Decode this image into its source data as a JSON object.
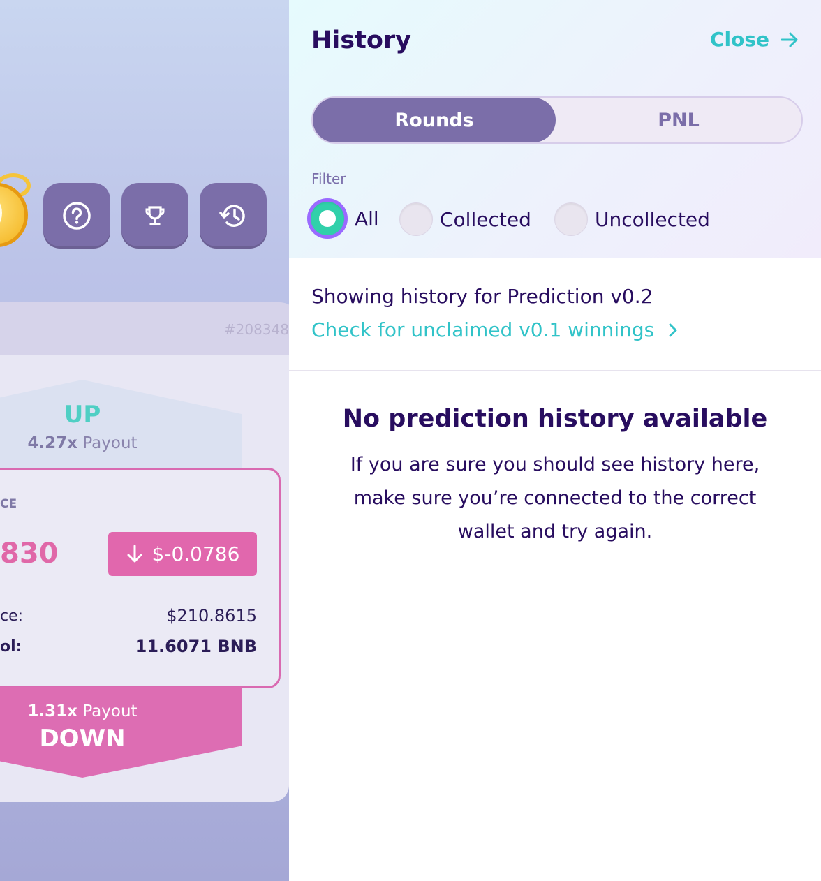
{
  "background": {
    "round_id": "#208348",
    "up": {
      "label": "UP",
      "payout_multiplier": "4.27x",
      "payout_word": "Payout"
    },
    "price": {
      "caption": "CE",
      "value": "830",
      "delta": "$-0.0786",
      "locked_label": "ce:",
      "locked_value": "$210.8615",
      "pool_label": "ol:",
      "pool_value": "11.6071 BNB"
    },
    "down": {
      "label": "DOWN",
      "payout_multiplier": "1.31x",
      "payout_word": "Payout"
    },
    "icons": [
      "timer-icon",
      "help-icon",
      "trophy-icon",
      "history-icon"
    ]
  },
  "panel": {
    "title": "History",
    "close_label": "Close",
    "tabs": [
      {
        "label": "Rounds",
        "active": true
      },
      {
        "label": "PNL",
        "active": false
      }
    ],
    "filter": {
      "label": "Filter",
      "options": [
        {
          "label": "All",
          "checked": true
        },
        {
          "label": "Collected",
          "checked": false
        },
        {
          "label": "Uncollected",
          "checked": false
        }
      ]
    },
    "info_text": "Showing history for Prediction v0.2",
    "unclaimed_link": "Check for unclaimed v0.1 winnings",
    "empty_title": "No prediction history available",
    "empty_text": "If you are sure you should see history here, make sure you’re connected to the correct wallet and try again."
  },
  "colors": {
    "accent_purple": "#7b6ea9",
    "accent_teal": "#31c3c8",
    "text_dark": "#280d5f",
    "pink": "#e167ad"
  }
}
